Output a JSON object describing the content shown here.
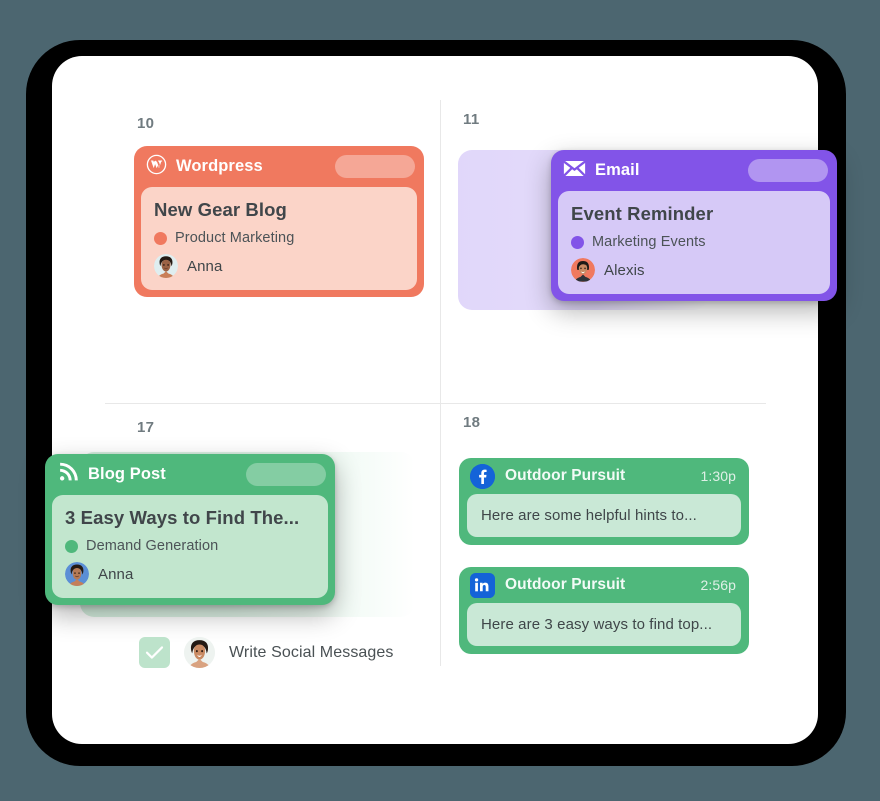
{
  "theme": {
    "page_background": "#4c6670",
    "frame_color": "#000000",
    "surface_color": "#ffffff",
    "grid_line": "#e8e8e8",
    "accent_coral": "#f0795f",
    "accent_purple": "#8254e8",
    "accent_green": "#4fb87c",
    "social_blue": "#1463d8"
  },
  "calendar": {
    "days": [
      {
        "number": "10"
      },
      {
        "number": "11"
      },
      {
        "number": "17"
      },
      {
        "number": "18"
      }
    ]
  },
  "cards": {
    "wordpress": {
      "channel": "Wordpress",
      "channel_icon": "wordpress-icon",
      "title": "New Gear Blog",
      "category": "Product Marketing",
      "owner": "Anna",
      "color": "#f0795f",
      "body_color": "#fbd4c8"
    },
    "email": {
      "channel": "Email",
      "channel_icon": "envelope-icon",
      "title": "Event Reminder",
      "category": "Marketing Events",
      "owner": "Alexis",
      "color": "#8254e8",
      "body_color": "#d6c9f7"
    },
    "blog": {
      "channel": "Blog Post",
      "channel_icon": "rss-icon",
      "title": "3 Easy Ways to Find The...",
      "category": "Demand Generation",
      "owner": "Anna",
      "color": "#4fb87c",
      "body_color": "#c2e6ce"
    }
  },
  "social_posts": [
    {
      "network": "facebook",
      "network_icon": "facebook-icon",
      "account": "Outdoor Pursuit",
      "time": "1:30p",
      "message": "Here are some helpful hints to..."
    },
    {
      "network": "linkedin",
      "network_icon": "linkedin-icon",
      "account": "Outdoor Pursuit",
      "time": "2:56p",
      "message": "Here are 3 easy ways to find top..."
    }
  ],
  "task": {
    "label": "Write Social Messages",
    "checked": true,
    "check_icon": "checkmark-icon",
    "assignee_avatar": "anna-avatar"
  }
}
